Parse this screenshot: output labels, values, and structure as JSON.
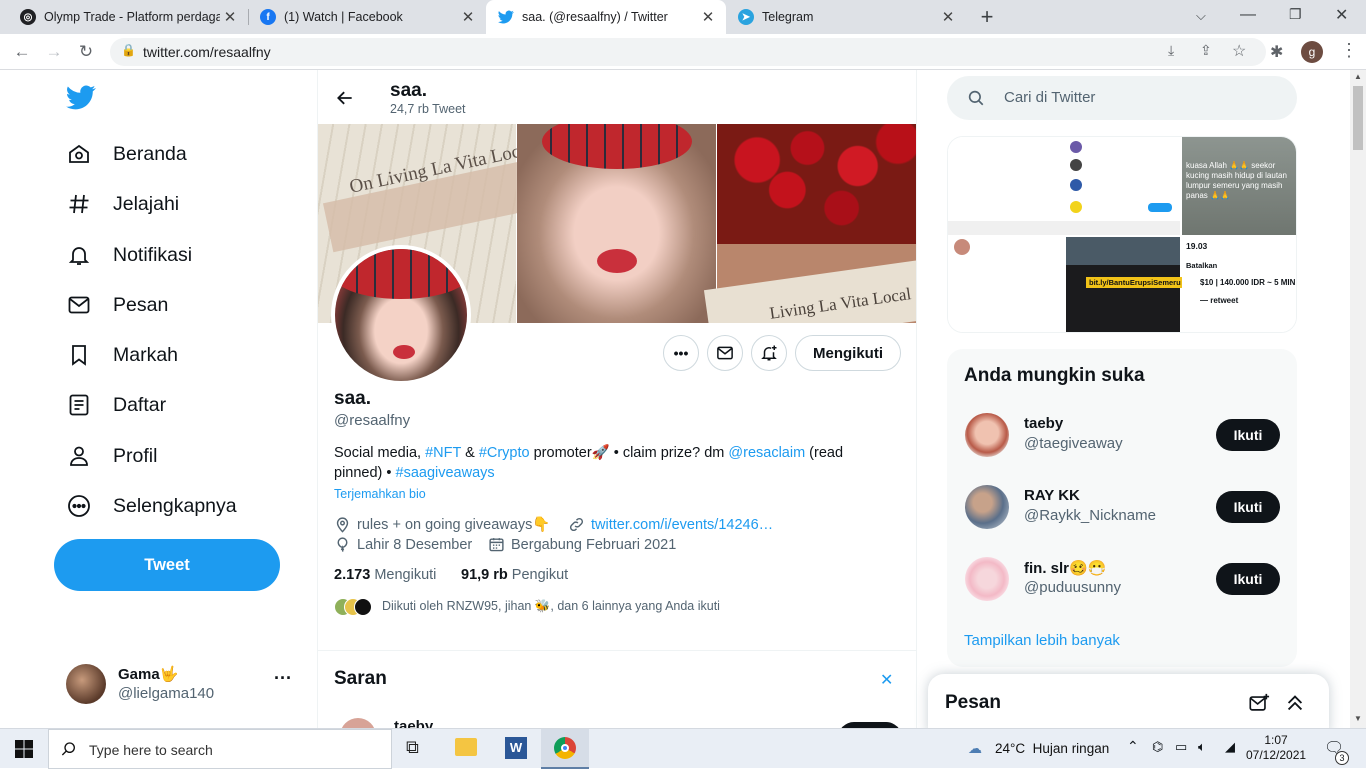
{
  "browser": {
    "tabs": [
      {
        "title": "Olymp Trade - Platform perdagangan",
        "close": "✕"
      },
      {
        "title": "(1) Watch | Facebook",
        "close": "✕"
      },
      {
        "title": "saa. (@resaalfny) / Twitter",
        "close": "✕"
      },
      {
        "title": "Telegram",
        "close": "✕"
      }
    ],
    "new_tab": "+",
    "url": "twitter.com/resaalfny",
    "profile_initial": "g"
  },
  "nav": {
    "items": [
      {
        "label": "Beranda",
        "icon": "home-icon"
      },
      {
        "label": "Jelajahi",
        "icon": "hashtag-icon"
      },
      {
        "label": "Notifikasi",
        "icon": "bell-icon"
      },
      {
        "label": "Pesan",
        "icon": "mail-icon"
      },
      {
        "label": "Markah",
        "icon": "bookmark-icon"
      },
      {
        "label": "Daftar",
        "icon": "list-icon"
      },
      {
        "label": "Profil",
        "icon": "person-icon"
      },
      {
        "label": "Selengkapnya",
        "icon": "more-circle-icon"
      }
    ],
    "tweet_button": "Tweet",
    "account": {
      "name": "Gama🤟",
      "handle": "@lielgama140"
    }
  },
  "profile": {
    "header_name": "saa.",
    "header_count": "24,7 rb Tweet",
    "name": "saa.",
    "handle": "@resaalfny",
    "follow_button": "Mengikuti",
    "bio_parts": {
      "t1": "Social media, ",
      "l1": "#NFT",
      "t2": " & ",
      "l2": "#Crypto",
      "t3": " promoter🚀 • claim prize? dm ",
      "l3": "@resaclaim",
      "t4": " (read pinned) • ",
      "l4": "#saagiveaways"
    },
    "translate": "Terjemahkan bio",
    "location": "rules + on going giveaways👇",
    "website": "twitter.com/i/events/14246…",
    "birthday": "Lahir 8 Desember",
    "joined": "Bergabung Februari 2021",
    "following_count": "2.173",
    "following_label": "Mengikuti",
    "followers_count": "91,9 rb",
    "followers_label": "Pengikut",
    "followed_by": "Diikuti oleh RNZW95, jihan 🐝, dan 6 lainnya yang Anda ikuti",
    "banner_text_left": "On Living La Vita Loca",
    "banner_text_right": "Living La Vita Local"
  },
  "saran": {
    "title": "Saran",
    "close": "✕",
    "first": "taeby"
  },
  "right": {
    "search_placeholder": "Cari di Twitter",
    "media_texts": {
      "t1": "kuasa Allah 🙏🙏 seekor kucing masih hidup di lautan lumpur semeru yang masih panas 🙏🙏",
      "t2": "bit.ly/BantuErupsiSemeru",
      "t3": "19.03",
      "t4": "Batalkan",
      "t5": "$10 | 140.000 IDR ~ 5 MIN",
      "t6": "— retweet"
    },
    "who_title": "Anda mungkin suka",
    "who": [
      {
        "name": "taeby",
        "handle": "@taegiveaway",
        "button": "Ikuti"
      },
      {
        "name": "RAY KK",
        "handle": "@Raykk_Nickname",
        "button": "Ikuti"
      },
      {
        "name": "fin. slr🥴😷",
        "handle": "@puduusunny",
        "button": "Ikuti"
      }
    ],
    "show_more": "Tampilkan lebih banyak",
    "messages_title": "Pesan"
  },
  "taskbar": {
    "search_placeholder": "Type here to search",
    "weather": "24°C  Hujan ringan",
    "time": "1:07",
    "date": "07/12/2021",
    "notif_count": "3"
  }
}
